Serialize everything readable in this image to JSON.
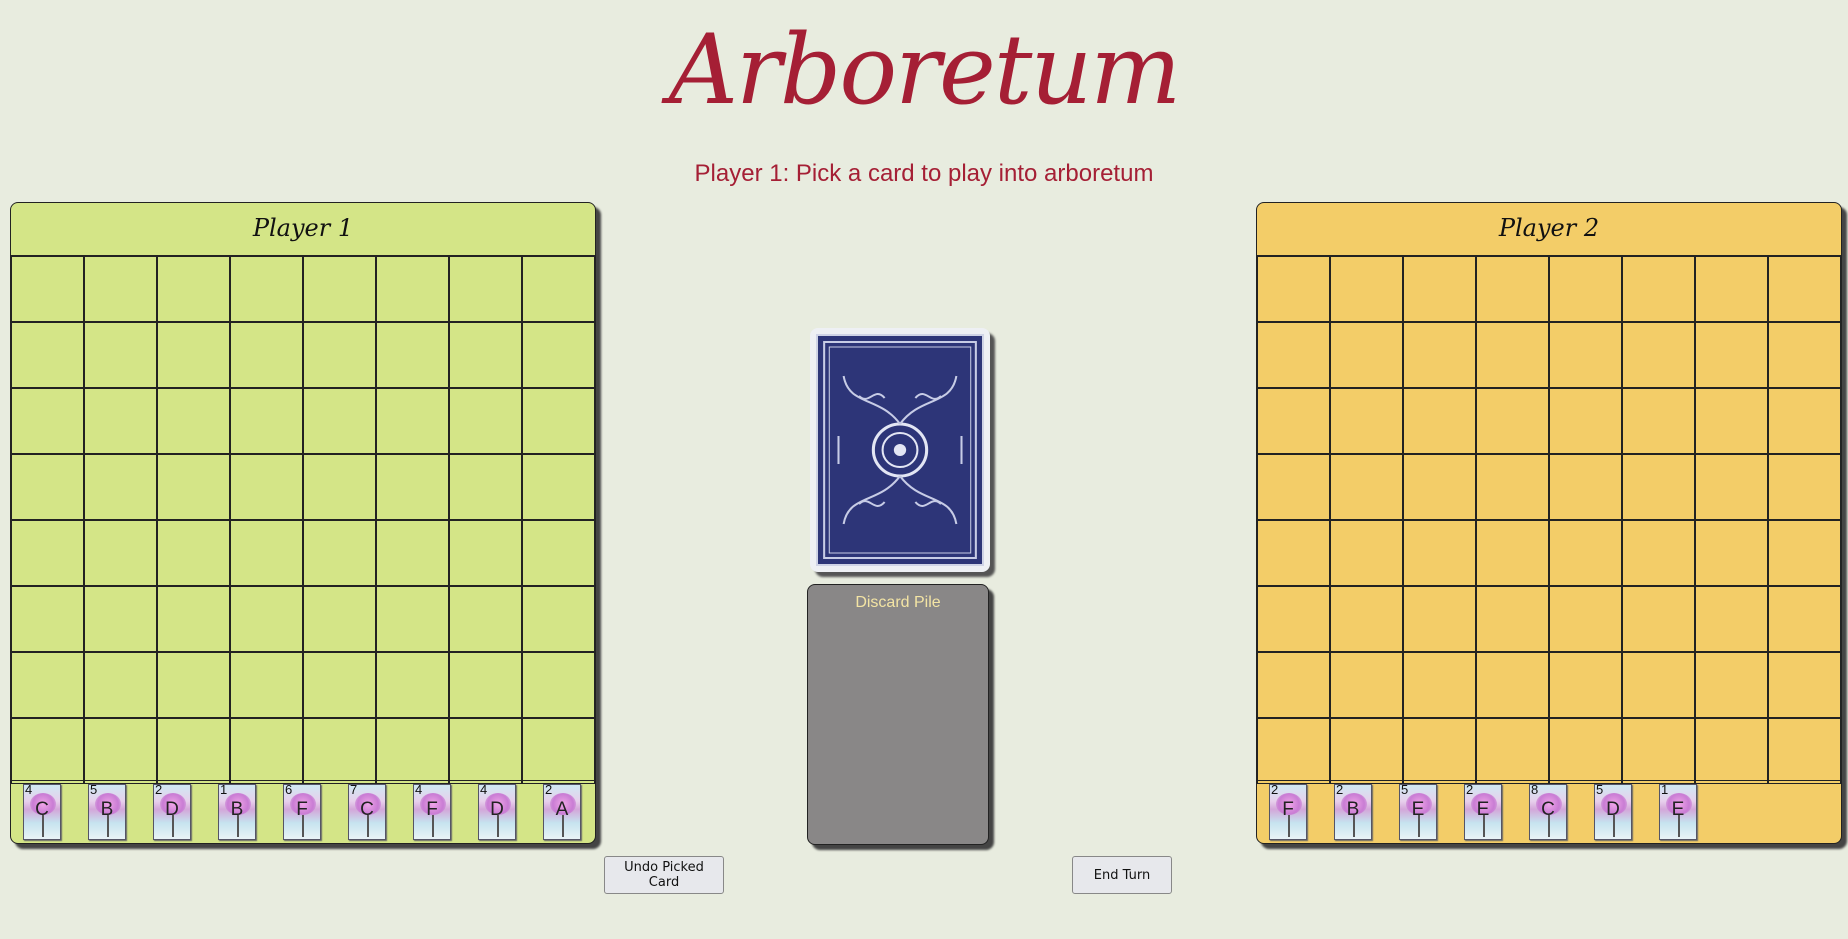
{
  "title": "Arboretum",
  "status": "Player 1: Pick a card to play into arboretum",
  "player1": {
    "name": "Player 1",
    "hand": [
      {
        "value": "4",
        "suit": "C"
      },
      {
        "value": "5",
        "suit": "B"
      },
      {
        "value": "2",
        "suit": "D"
      },
      {
        "value": "1",
        "suit": "B"
      },
      {
        "value": "6",
        "suit": "F"
      },
      {
        "value": "7",
        "suit": "C"
      },
      {
        "value": "4",
        "suit": "F"
      },
      {
        "value": "4",
        "suit": "D"
      },
      {
        "value": "2",
        "suit": "A"
      }
    ]
  },
  "player2": {
    "name": "Player 2",
    "hand": [
      {
        "value": "2",
        "suit": "F"
      },
      {
        "value": "2",
        "suit": "B"
      },
      {
        "value": "5",
        "suit": "E"
      },
      {
        "value": "2",
        "suit": "E"
      },
      {
        "value": "8",
        "suit": "C"
      },
      {
        "value": "5",
        "suit": "D"
      },
      {
        "value": "1",
        "suit": "E"
      }
    ]
  },
  "discard_label": "Discard Pile",
  "buttons": {
    "undo": "Undo Picked Card",
    "end_turn": "End Turn"
  },
  "colors": {
    "accent": "#a51f35",
    "player1_board": "#d4e587",
    "player2_board": "#f3cd68",
    "deck_back": "#2d3578",
    "discard": "#898787"
  }
}
